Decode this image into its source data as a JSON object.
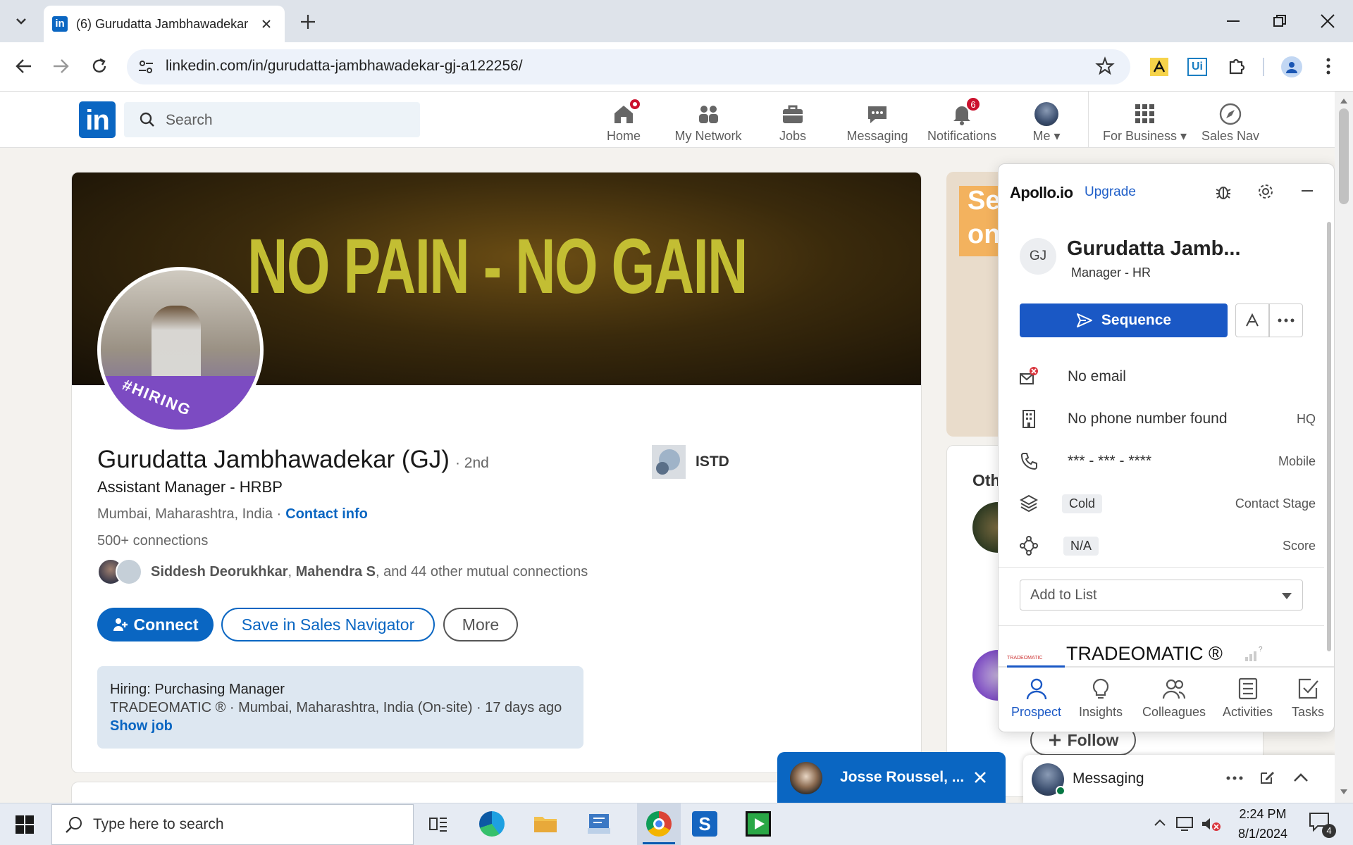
{
  "browser": {
    "tab_title": "(6) Gurudatta Jambhawadekar (",
    "url": "linkedin.com/in/gurudatta-jambhawadekar-gj-a122256/"
  },
  "linkedin_nav": {
    "logo": "in",
    "search_placeholder": "Search",
    "items": [
      {
        "label": "Home",
        "icon": "home-icon"
      },
      {
        "label": "My Network",
        "icon": "people-icon"
      },
      {
        "label": "Jobs",
        "icon": "briefcase-icon"
      },
      {
        "label": "Messaging",
        "icon": "chat-icon"
      },
      {
        "label": "Notifications",
        "icon": "bell-icon",
        "badge": "6"
      },
      {
        "label": "Me",
        "icon": "avatar"
      },
      {
        "label": "For Business",
        "icon": "grid-icon"
      },
      {
        "label": "Sales Nav",
        "icon": "compass-icon"
      }
    ]
  },
  "profile": {
    "banner_text": "NO PAIN - NO GAIN",
    "avatar_ribbon": "#HIRING",
    "name": "Gurudatta Jambhawadekar (GJ)",
    "degree": "· 2nd",
    "headline": "Assistant Manager - HRBP",
    "location": "Mumbai, Maharashtra, India ·",
    "contact_info": "Contact info",
    "connections": "500+ connections",
    "mutual_name1": "Siddesh Deorukhkar",
    "mutual_sep": ",",
    "mutual_name2": "Mahendra S",
    "mutual_rest": ", and 44 other mutual connections",
    "org": "ISTD",
    "connect_label": "Connect",
    "save_sales_nav_label": "Save in Sales Navigator",
    "more_label": "More",
    "job": {
      "title": "Hiring: Purchasing Manager",
      "detail": "TRADEOMATIC ® · Mumbai, Maharashtra, India (On-site) · 17 days ago",
      "link": "Show job"
    }
  },
  "sidebar": {
    "ad_text_1": "Se",
    "ad_text_2": "on",
    "other_heading": "Oth",
    "follow_label": "Follow"
  },
  "apollo": {
    "logo": "Apollo.io",
    "upgrade": "Upgrade",
    "initials": "GJ",
    "name": "Gurudatta Jamb...",
    "title": "Manager - HR",
    "sequence_label": "Sequence",
    "email": "No email",
    "phone": "No phone number found",
    "phone_tag": "HQ",
    "mobile": "*** - *** - ****",
    "mobile_tag": "Mobile",
    "stage_value": "Cold",
    "stage_label": "Contact Stage",
    "score_value": "N/A",
    "score_label": "Score",
    "add_to_list": "Add to List",
    "company": "TRADEOMATIC ®",
    "company_logo_text": "TRADEOMATIC",
    "tabs": [
      "Prospect",
      "Insights",
      "Colleagues",
      "Activities",
      "Tasks"
    ]
  },
  "chat_popup": {
    "name": "Josse Roussel, ..."
  },
  "messaging_popup": {
    "label": "Messaging"
  },
  "taskbar": {
    "search_placeholder": "Type here to search",
    "time": "2:24 PM",
    "date": "8/1/2024",
    "notif_count": "4"
  }
}
